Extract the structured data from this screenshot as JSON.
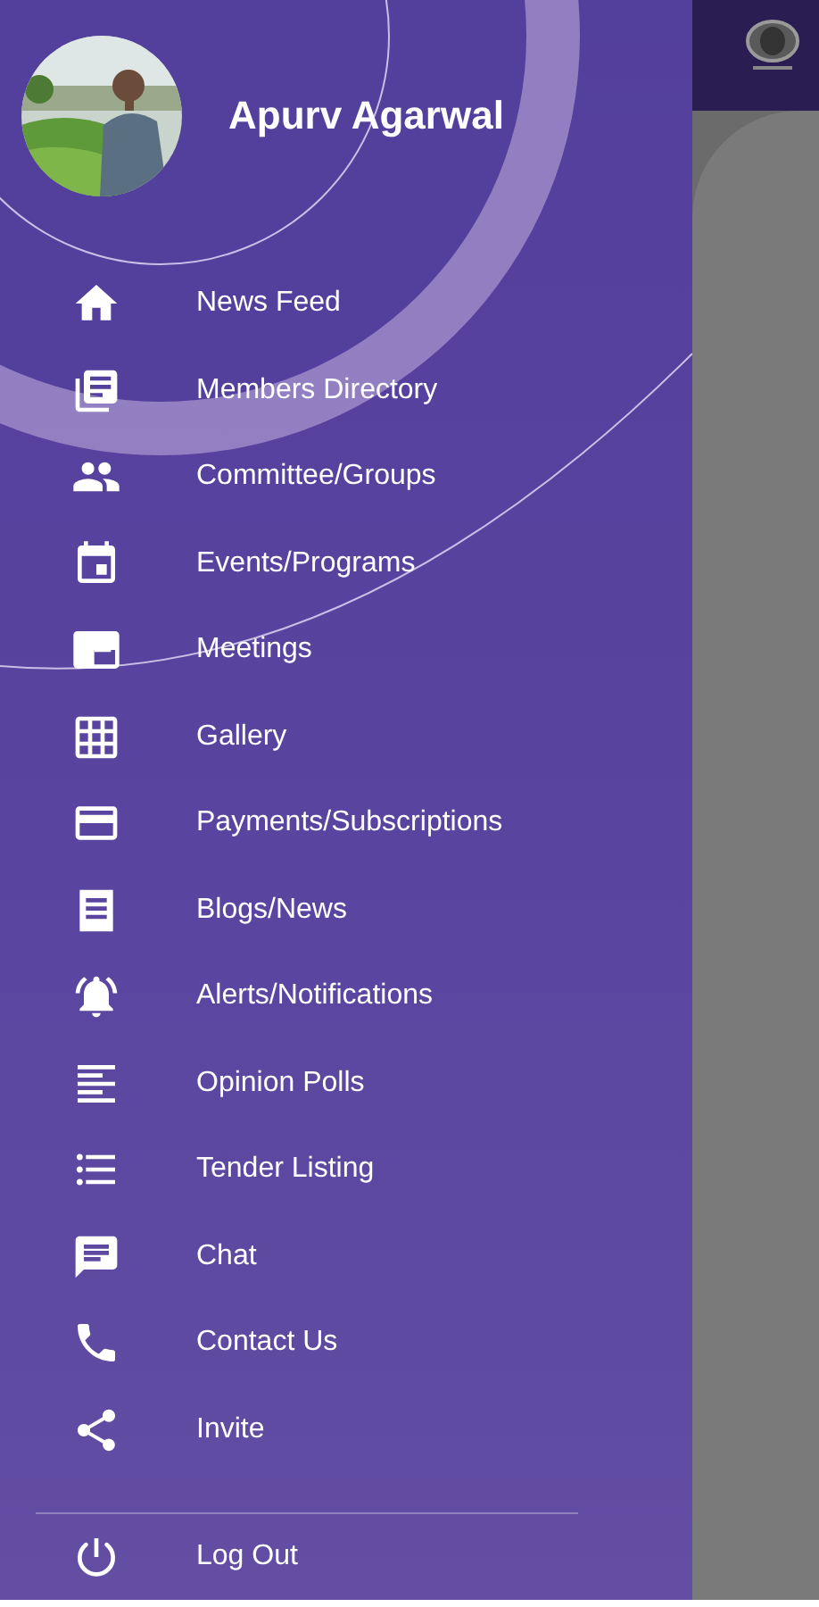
{
  "profile": {
    "name": "Apurv Agarwal"
  },
  "menu": [
    {
      "label": "News Feed"
    },
    {
      "label": "Members Directory"
    },
    {
      "label": "Committee/Groups"
    },
    {
      "label": "Events/Programs"
    },
    {
      "label": "Meetings"
    },
    {
      "label": "Gallery"
    },
    {
      "label": "Payments/Subscriptions"
    },
    {
      "label": "Blogs/News"
    },
    {
      "label": "Alerts/Notifications"
    },
    {
      "label": "Opinion Polls"
    },
    {
      "label": "Tender Listing"
    },
    {
      "label": "Chat"
    },
    {
      "label": "Contact Us"
    },
    {
      "label": "Invite"
    }
  ],
  "footer_item": {
    "label": "Log Out"
  }
}
